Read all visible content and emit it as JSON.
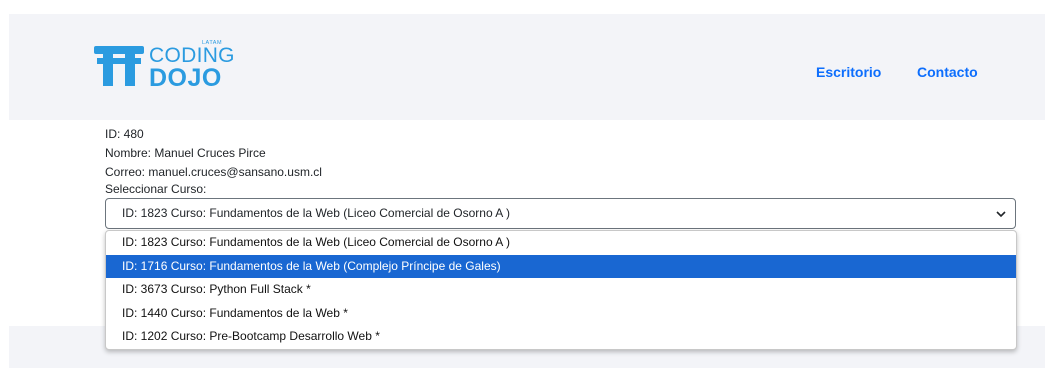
{
  "header": {
    "logo": {
      "latam": "LATAM",
      "coding": "CODING",
      "dojo": "DOJO"
    },
    "nav": [
      {
        "label": "Escritorio"
      },
      {
        "label": "Contacto"
      }
    ],
    "accent_color": "#0d6efd",
    "logo_color": "#2b9be0"
  },
  "student": {
    "id": "ID: 480",
    "nombre": "Nombre: Manuel Cruces Pirce",
    "correo": "Correo: manuel.cruces@sansano.usm.cl",
    "select_label": "Seleccionar Curso:"
  },
  "course_select": {
    "selected_value": "ID: 1823 Curso: Fundamentos de la Web (Liceo Comercial de Osorno A )",
    "options": [
      "ID: 1823 Curso: Fundamentos de la Web (Liceo Comercial de Osorno A )",
      "ID: 1716 Curso: Fundamentos de la Web (Complejo Príncipe de Gales)",
      "ID: 3673 Curso: Python Full Stack *",
      "ID: 1440 Curso: Fundamentos de la Web *",
      "ID: 1202 Curso: Pre-Bootcamp Desarrollo Web *"
    ],
    "highlighted_index": 1,
    "highlight_color": "#1967d2"
  }
}
